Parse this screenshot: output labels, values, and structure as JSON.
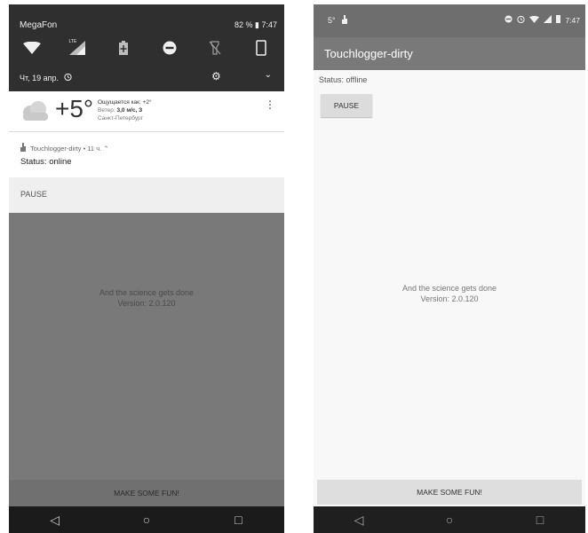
{
  "left_phone": {
    "quick_settings": {
      "carrier": "MegaFon",
      "battery_time": "82 % ▮ 7:47",
      "date": "Чт, 19 апр.",
      "lte_badge": "LTE",
      "tiles": [
        "wifi-icon",
        "cellular-lte-icon",
        "battery-saver-icon",
        "do-not-disturb-icon",
        "flashlight-off-icon",
        "rotate-icon"
      ]
    },
    "weather": {
      "temperature": "+5°",
      "feels_like": "Ощущается как: +2°",
      "wind_label": "Ветер: ",
      "wind_value": "3,0 м/с, З",
      "city": "Санкт-Петербург"
    },
    "notification": {
      "header": "Touchlogger-dirty • 11 ч. ⌃",
      "status": "Status: online"
    },
    "pause_label": "PAUSE",
    "message": {
      "line1": "And the science gets done",
      "line2": "Version: 2.0.120"
    },
    "fun_label": "MAKE SOME FUN!"
  },
  "right_phone": {
    "status_bar": {
      "temp": "5°",
      "time": "7:47"
    },
    "app_title": "Touchlogger-dirty",
    "status": "Status: offline",
    "pause_label": "PAUSE",
    "message": {
      "line1": "And the science gets done",
      "line2": "Version: 2.0.120"
    },
    "fun_label": "MAKE SOME FUN!"
  },
  "nav_glyphs": {
    "back": "◁",
    "home": "○",
    "recents": "□"
  }
}
